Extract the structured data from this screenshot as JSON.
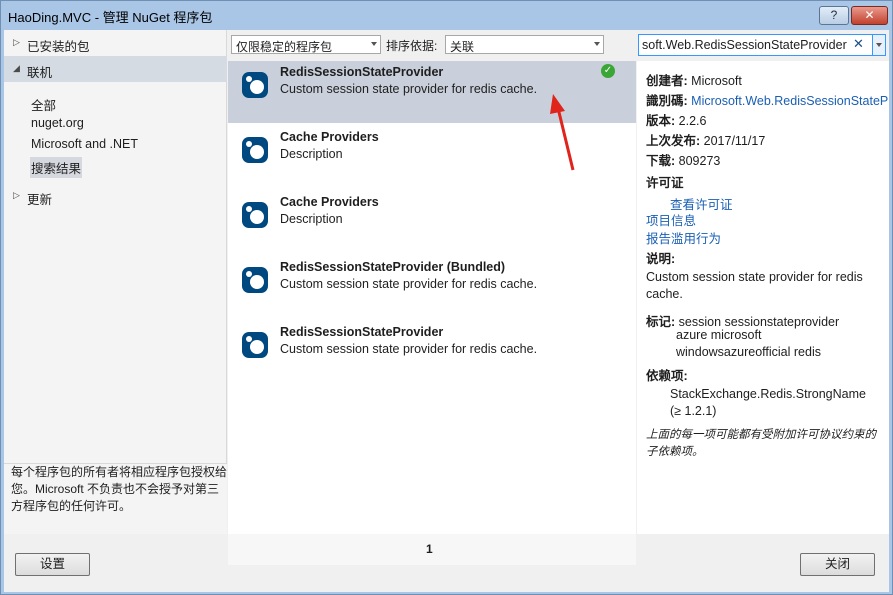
{
  "window": {
    "title": "HaoDing.MVC - 管理 NuGet 程序包",
    "help_label": "?",
    "close_label": "✕"
  },
  "sidebar": {
    "installed_label": "已安装的包",
    "online_label": "联机",
    "online_items": [
      {
        "label": "全部"
      },
      {
        "label": "nuget.org"
      },
      {
        "label": "Microsoft and .NET"
      },
      {
        "label": "搜索结果"
      }
    ],
    "updates_label": "更新",
    "license_note": "每个程序包的所有者将相应程序包授权给您。Microsoft 不负责也不会授予对第三方程序包的任何许可。"
  },
  "toolbar": {
    "filter_value": "仅限稳定的程序包",
    "sort_label": "排序依据:",
    "sort_value": "关联",
    "search_value": "soft.Web.RedisSessionStateProvider",
    "search_clear": "✕"
  },
  "results": [
    {
      "name": "RedisSessionStateProvider",
      "description": "Custom session state provider for redis cache.",
      "installed": true
    },
    {
      "name": "Cache Providers",
      "description": "Description",
      "installed": false
    },
    {
      "name": "Cache Providers",
      "description": "Description",
      "installed": false
    },
    {
      "name": "RedisSessionStateProvider (Bundled)",
      "description": "Custom session state provider for redis cache.",
      "installed": false
    },
    {
      "name": "RedisSessionStateProvider",
      "description": "Custom session state provider for redis cache.",
      "installed": false
    }
  ],
  "pager": {
    "current_page": "1"
  },
  "details": {
    "author_label": "创建者:",
    "author": "Microsoft",
    "id_label": "識別碼:",
    "id": "Microsoft.Web.RedisSessionStateProvider",
    "version_label": "版本:",
    "version": "2.2.6",
    "published_label": "上次发布:",
    "published": "2017/11/17",
    "downloads_label": "下载:",
    "downloads": "809273",
    "license_heading": "许可证",
    "view_license": "查看许可证",
    "project_info": "项目信息",
    "report_abuse": "报告滥用行为",
    "description_heading": "说明:",
    "description": "Custom session state provider for redis cache.",
    "tags_label": "标记:",
    "tags_line1": "session sessionstateprovider",
    "tags_line2": "azure microsoft",
    "tags_line3": "windowsazureofficial redis",
    "dependencies_heading": "依赖项:",
    "dependency_name": "StackExchange.Redis.StrongName",
    "dependency_version": "(≥ 1.2.1)",
    "footnote": "上面的每一项可能都有受附加许可协议约束的子依赖项。"
  },
  "buttons": {
    "settings_label": "设置",
    "close_label": "关闭"
  },
  "colors": {
    "accent": "#3399ff",
    "selected_row": "#c9d0db",
    "link": "#1a5fb4",
    "annotation_arrow": "#e0231b",
    "installed_check": "#3aa636"
  }
}
